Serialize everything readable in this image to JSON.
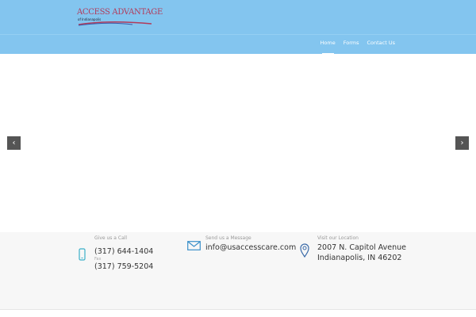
{
  "header": {
    "logo_text": "ACCESS ADVANTAGE",
    "logo_sub": "of Indianapolis",
    "nav": [
      {
        "label": "Home",
        "active": true
      },
      {
        "label": "Forms"
      },
      {
        "label": "Contact Us"
      }
    ]
  },
  "slider": {
    "prev": "‹",
    "next": "›"
  },
  "contact": {
    "call": {
      "label": "Give us a Call",
      "phone": "(317) 644-1404",
      "fax_label": "Fax",
      "fax": "(317) 759-5204"
    },
    "message": {
      "label": "Send us a Message",
      "email": "info@usaccesscare.com"
    },
    "location": {
      "label": "Visit our Location",
      "line1": "2007 N. Capitol Avenue",
      "line2": "Indianapolis, IN 46202"
    }
  }
}
